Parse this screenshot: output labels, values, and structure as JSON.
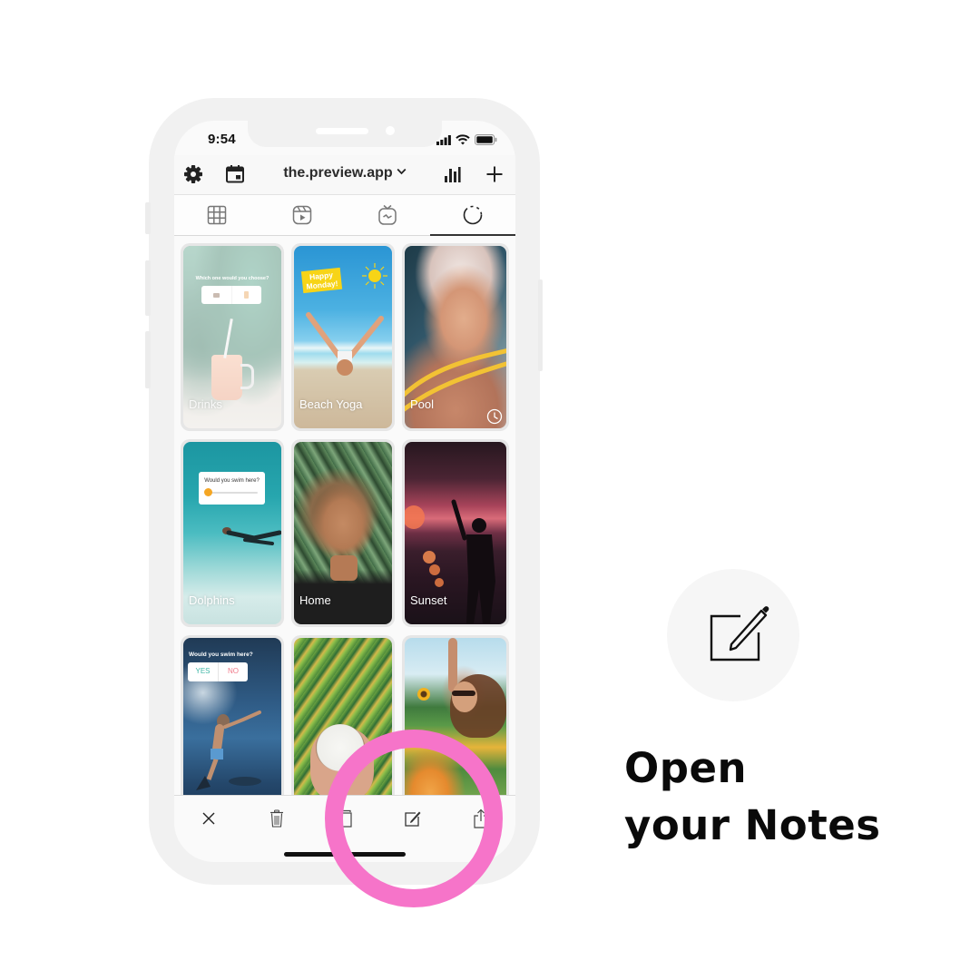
{
  "status_bar": {
    "time": "9:54",
    "icons": [
      "signal-icon",
      "wifi-icon",
      "battery-icon"
    ]
  },
  "header": {
    "left_icons": [
      "gear-icon",
      "calendar-icon"
    ],
    "account": "the.preview.app",
    "account_dropdown_icon": "chevron-down-icon",
    "right_icons": [
      "bar-chart-icon",
      "plus-icon"
    ]
  },
  "tabs": [
    {
      "name": "grid",
      "icon": "grid-icon",
      "active": false
    },
    {
      "name": "reels",
      "icon": "reels-icon",
      "active": false
    },
    {
      "name": "igtv",
      "icon": "igtv-icon",
      "active": false
    },
    {
      "name": "stories",
      "icon": "stories-icon",
      "active": true
    }
  ],
  "stories": [
    {
      "label": "Drinks",
      "faded": true,
      "sticker": {
        "type": "poll",
        "question": "Which one would you choose?"
      }
    },
    {
      "label": "Beach Yoga",
      "sticker": {
        "type": "text",
        "line1": "Happy",
        "line2": "Monday!"
      }
    },
    {
      "label": "Pool",
      "scheduled": true,
      "badge_icon": "clock-icon"
    },
    {
      "label": "Dolphins",
      "sticker": {
        "type": "slider",
        "question": "Would you swim here?"
      }
    },
    {
      "label": "Home"
    },
    {
      "label": "Sunset"
    },
    {
      "label": "",
      "sticker": {
        "type": "poll",
        "question": "Would you swim here?",
        "options": [
          "YES",
          "NO"
        ]
      }
    },
    {
      "label": ""
    },
    {
      "label": ""
    }
  ],
  "toolbar": [
    {
      "name": "close",
      "icon": "close-icon"
    },
    {
      "name": "delete",
      "icon": "trash-icon"
    },
    {
      "name": "duplicate",
      "icon": "duplicate-icon"
    },
    {
      "name": "notes",
      "icon": "edit-icon"
    },
    {
      "name": "share",
      "icon": "share-icon"
    }
  ],
  "highlight": {
    "target": "notes",
    "color": "#f674c9"
  },
  "callout": {
    "icon": "edit-icon",
    "line1": "Open",
    "line2": "your Notes"
  },
  "colors": {
    "frame": "#f1f1f1",
    "accent_pink": "#f674c9",
    "poll_yes": "#3fb7a7",
    "poll_no": "#f07a8a",
    "sticker_yellow": "#f7d417"
  }
}
